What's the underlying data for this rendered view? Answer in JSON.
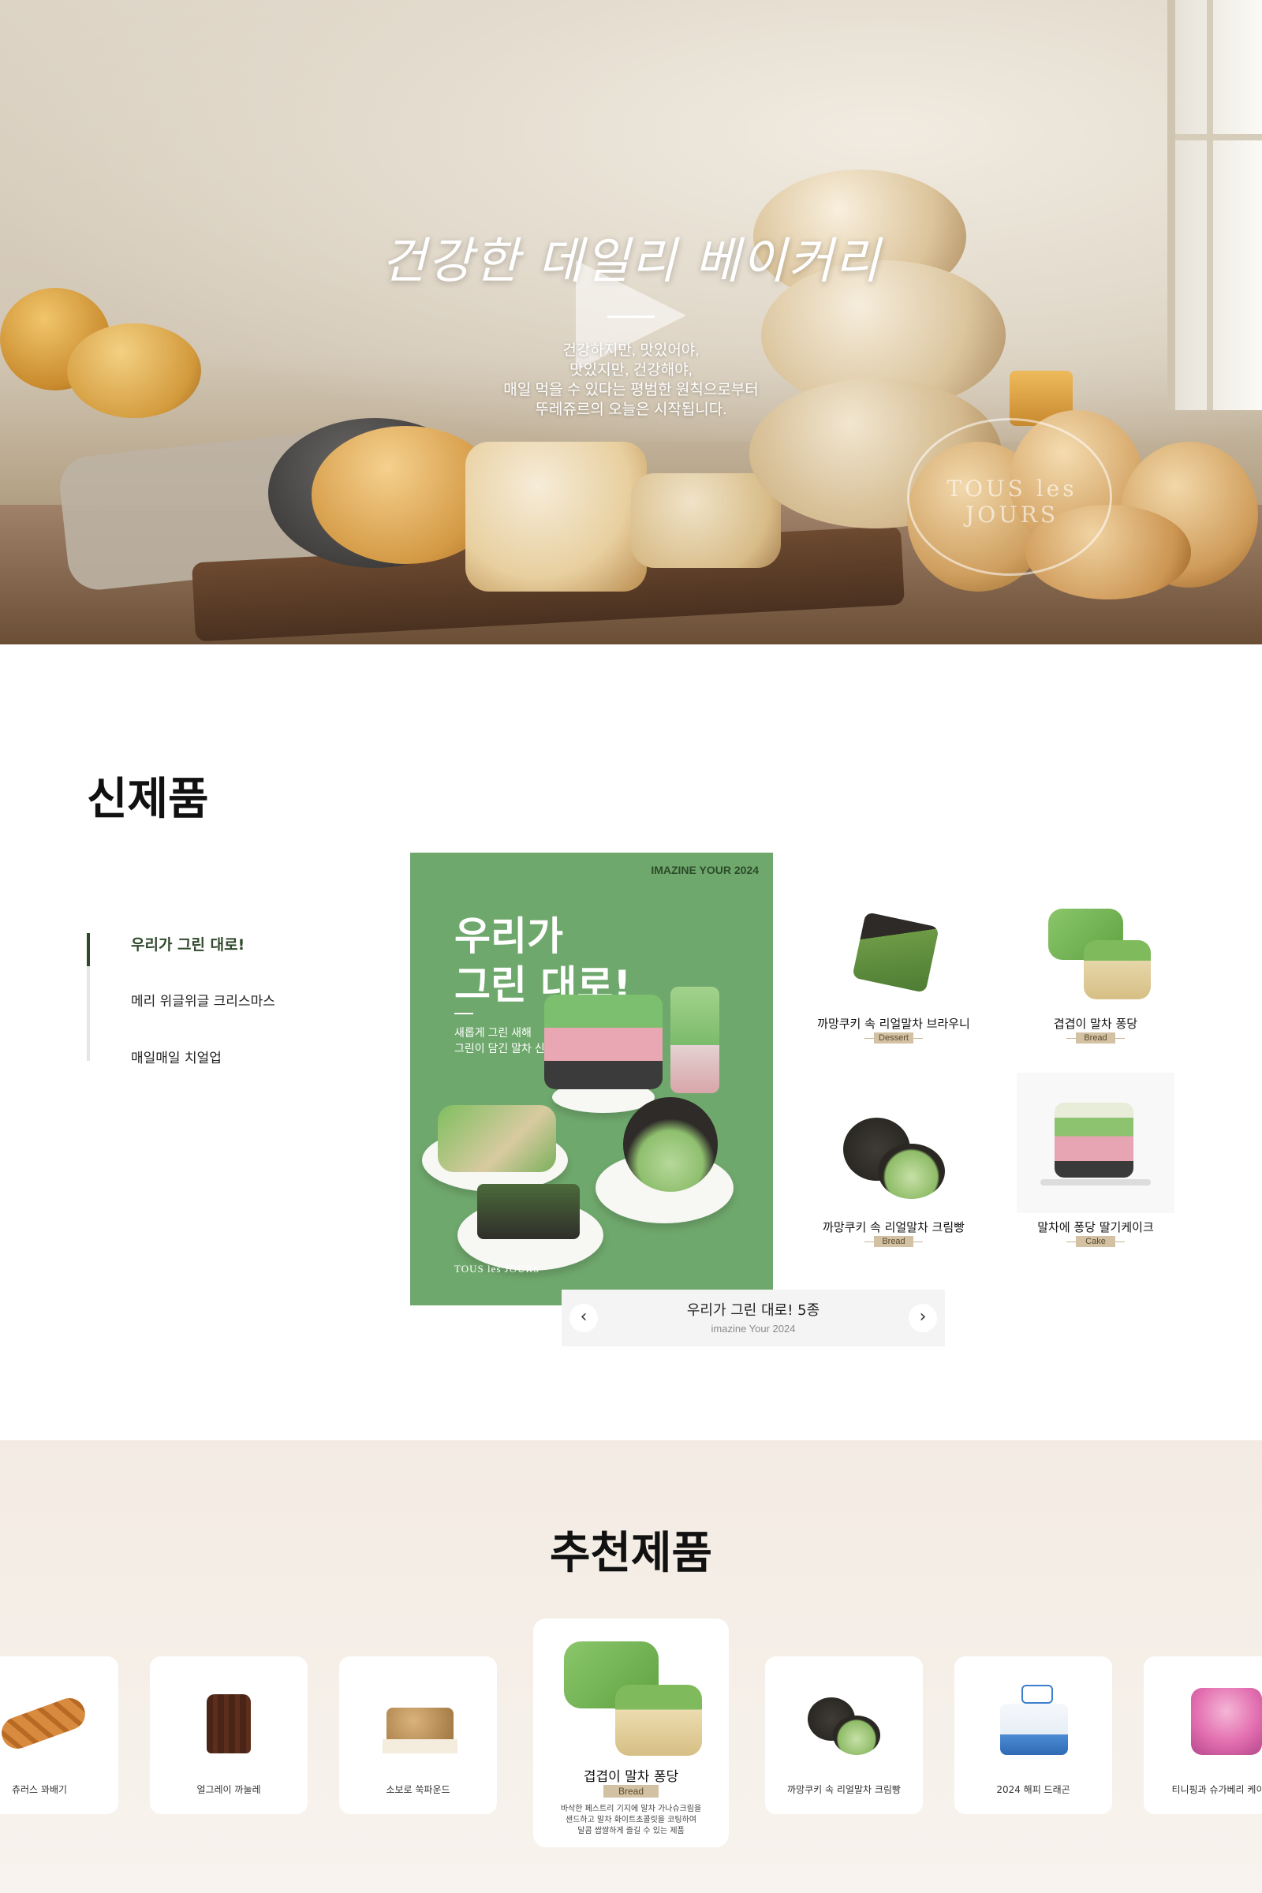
{
  "hero": {
    "title": "건강한 데일리 베이커리",
    "description": [
      "건강하지만, 맛있어야,",
      "맛있지만, 건강해야,",
      "매일 먹을 수 있다는 평범한 원칙으로부터",
      "뚜레쥬르의 오늘은 시작됩니다."
    ],
    "play_icon": "play-icon"
  },
  "new_products": {
    "title": "신제품",
    "tabs": [
      {
        "label": "우리가 그린 대로!",
        "active": true
      },
      {
        "label": "메리 위글위글 크리스마스",
        "active": false
      },
      {
        "label": "매일매일 치얼업",
        "active": false
      }
    ],
    "promo": {
      "tag": "IMAZINE YOUR 2024",
      "headline": [
        "우리가",
        "그린 대로!"
      ],
      "subline": [
        "새롭게 그린 새해",
        "그린이 담긴 말차 신제품"
      ],
      "brand": "TOUS les JOURS"
    },
    "products": [
      {
        "name": "까망쿠키 속 리얼말차 브라우니",
        "category": "Dessert"
      },
      {
        "name": "겹겹이 말차 퐁당",
        "category": "Bread"
      },
      {
        "name": "까망쿠키 속 리얼말차 크림빵",
        "category": "Bread"
      },
      {
        "name": "말차에 퐁당 딸기케이크",
        "category": "Cake"
      }
    ],
    "slider": {
      "title": "우리가 그린 대로! 5종",
      "subtitle": "imazine Your 2024",
      "prev_icon": "chevron-left-icon",
      "next_icon": "chevron-right-icon"
    }
  },
  "recommended": {
    "title": "추천제품",
    "items": [
      {
        "name": "츄러스 꽈배기"
      },
      {
        "name": "얼그레이 까눌레"
      },
      {
        "name": "소보로 쑥파운드"
      },
      {
        "name": "까망쿠키 속 리얼말차 크림빵"
      },
      {
        "name": "2024 해피 드래곤"
      },
      {
        "name": "티니핑과 슈가베리 케이크"
      }
    ],
    "featured": {
      "name": "겹겹이 말차 퐁당",
      "category": "Bread",
      "description": [
        "바삭한 페스트리 기지에 말차 가나슈크림을",
        "샌드하고 말차 화이트초콜릿을 코팅하여",
        "달콤 쌉쌀하게 즐길 수 있는 제품"
      ]
    }
  },
  "colors": {
    "accent_green": "#2f4a2b",
    "promo_green": "#6fa86c",
    "category_tag": "#d3c1a3",
    "recommended_bg": "#f3ebe3"
  }
}
